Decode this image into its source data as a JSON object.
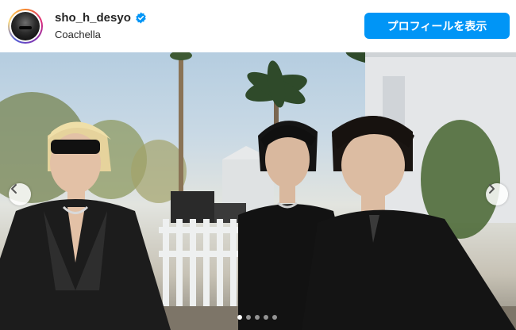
{
  "post": {
    "username": "sho_h_desyo",
    "location": "Coachella",
    "verified": true,
    "profile_button_label": "プロフィールを表示"
  },
  "carousel": {
    "slide_count": 5,
    "active_index": 0,
    "prev_icon": "chevron-left-icon",
    "next_icon": "chevron-right-icon"
  },
  "colors": {
    "accent": "#0095f6",
    "verified_badge": "#0095f6"
  }
}
